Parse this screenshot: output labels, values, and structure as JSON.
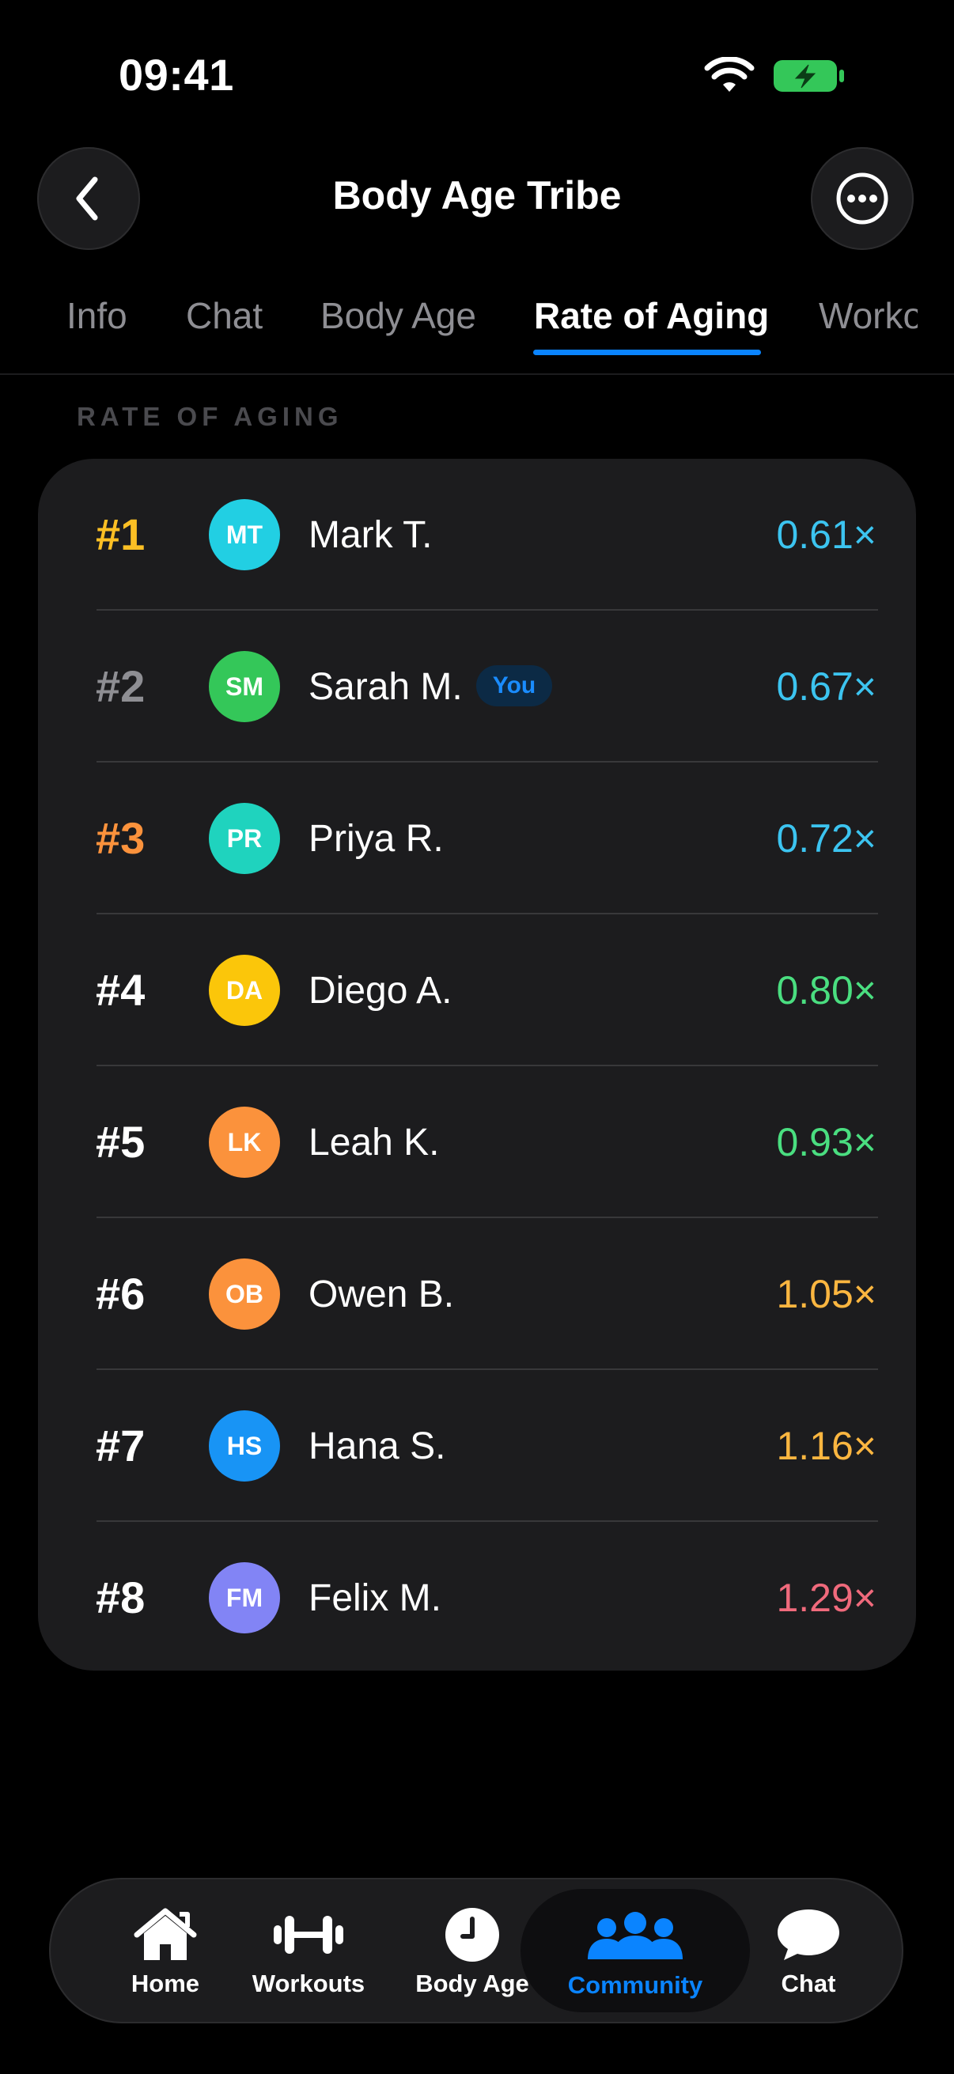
{
  "status_bar": {
    "time": "09:41"
  },
  "header": {
    "title": "Body Age Tribe"
  },
  "tabs": [
    {
      "label": "Info"
    },
    {
      "label": "Chat"
    },
    {
      "label": "Body Age"
    },
    {
      "label": "Rate of Aging"
    },
    {
      "label": "Workouts"
    }
  ],
  "section": {
    "label": "RATE OF AGING"
  },
  "leaderboard": [
    {
      "rank": "#1",
      "initials": "MT",
      "name": "Mark T.",
      "rate": "0.61×",
      "rank_color": "#fbbf24",
      "rate_color": "#3cc4f0",
      "avatar_color": "#22cfe3"
    },
    {
      "rank": "#2",
      "initials": "SM",
      "name": "Sarah M.",
      "badge": "You",
      "rate": "0.67×",
      "rank_color": "#8e8e93",
      "rate_color": "#3cc4f0",
      "avatar_color": "#34c759"
    },
    {
      "rank": "#3",
      "initials": "PR",
      "name": "Priya R.",
      "rate": "0.72×",
      "rank_color": "#fb923c",
      "rate_color": "#3cc4f0",
      "avatar_color": "#1fd3be"
    },
    {
      "rank": "#4",
      "initials": "DA",
      "name": "Diego A.",
      "rate": "0.80×",
      "rank_color": "#ffffff",
      "rate_color": "#4ade80",
      "avatar_color": "#fbc60a"
    },
    {
      "rank": "#5",
      "initials": "LK",
      "name": "Leah K.",
      "rate": "0.93×",
      "rank_color": "#ffffff",
      "rate_color": "#4ade80",
      "avatar_color": "#fb923c"
    },
    {
      "rank": "#6",
      "initials": "OB",
      "name": "Owen B.",
      "rate": "1.05×",
      "rank_color": "#ffffff",
      "rate_color": "#fbb640",
      "avatar_color": "#fb923c"
    },
    {
      "rank": "#7",
      "initials": "HS",
      "name": "Hana S.",
      "rate": "1.16×",
      "rank_color": "#ffffff",
      "rate_color": "#fbb640",
      "avatar_color": "#1894f5"
    },
    {
      "rank": "#8",
      "initials": "FM",
      "name": "Felix M.",
      "rate": "1.29×",
      "rank_color": "#ffffff",
      "rate_color": "#f06a7c",
      "avatar_color": "#8284f5"
    }
  ],
  "tab_bar": {
    "items": [
      {
        "label": "Home",
        "icon": "house-icon"
      },
      {
        "label": "Workouts",
        "icon": "dumbbell-icon"
      },
      {
        "label": "Body Age",
        "icon": "clock-icon"
      },
      {
        "label": "Community",
        "icon": "people-icon",
        "active": true
      },
      {
        "label": "Chat",
        "icon": "chat-bubble-icon"
      }
    ]
  },
  "colors": {
    "accent": "#0a84ff",
    "card": "#1c1c1e",
    "battery": "#34c759"
  }
}
